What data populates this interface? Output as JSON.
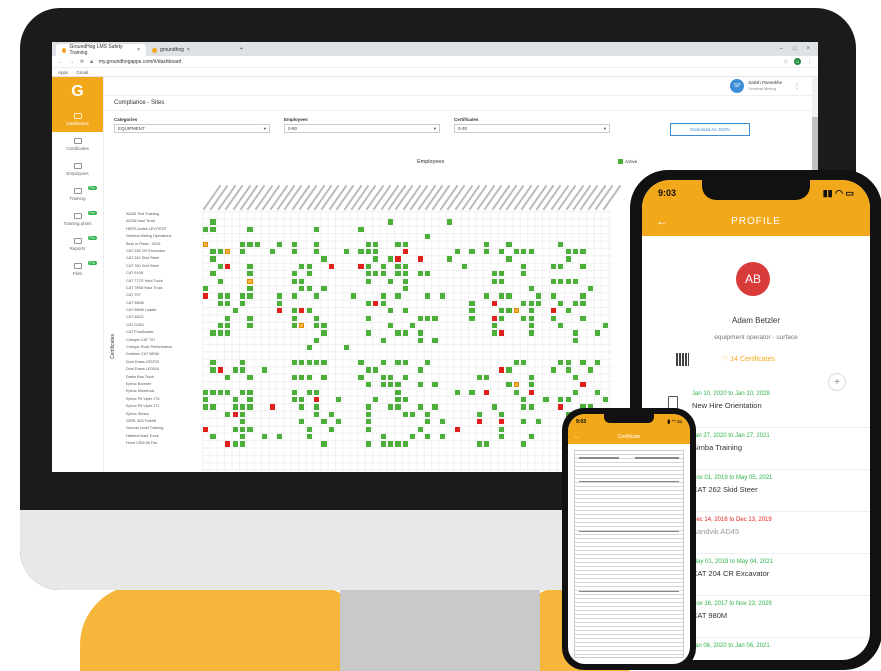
{
  "browser": {
    "tabs": [
      {
        "label": "GroundHog LMS Safety Training"
      },
      {
        "label": "groundhog"
      }
    ],
    "url": "my.groundhogapps.com/#/dashboard",
    "bookmarks": [
      "Apps",
      "Gmail"
    ],
    "account_initial": "G"
  },
  "app": {
    "logo": "G",
    "nav": [
      {
        "label": "Dashboard",
        "active": true
      },
      {
        "label": "Certificates"
      },
      {
        "label": "Employees"
      },
      {
        "label": "Training",
        "badge": "Pro"
      },
      {
        "label": "Training plans",
        "badge": "Pro"
      },
      {
        "label": "Reports",
        "badge": "Pro"
      },
      {
        "label": "Files",
        "badge": "Pro"
      }
    ],
    "user": {
      "initials": "SP",
      "name": "Satish Pansekhe",
      "subtitle": "Xcentral Mining"
    },
    "page_title": "Compliance - Sites",
    "filters": [
      {
        "label": "Categories",
        "value": "EQUIPMENT"
      },
      {
        "label": "Employees",
        "value": "0-50"
      },
      {
        "label": "Certificates",
        "value": "0-30"
      }
    ],
    "download_button": "Download As JSON",
    "matrix": {
      "employees_label": "Employees",
      "certificates_label": "Certificates",
      "legend_active": "Active",
      "rows": [
        "ADAS Test Training",
        "ADSA Haul Truck",
        "HERS Active LEVITEST",
        "General Mining Operations",
        "Bear in Place - 2019",
        "CAT 236 CR Excavator",
        "CAT 262 Skid Steer",
        "CAT 760 Grid Steer",
        "CAT 914B",
        "CAT 777G Haul Truck",
        "CAT 789D Haul Truck",
        "CAT 797",
        "CAT 980M",
        "CAT 980M Loader",
        "CAT AD22",
        "CAT D10U",
        "CAT Frontloader",
        "Chrispix CAT 797",
        "Chrispix Rock Performance",
        "Dobbies CAT 980M",
        "Doni Drass 22SF20",
        "Doni Drass LE0516",
        "Drake Bus Truck",
        "Epiroc Boomer",
        "Epiroc Minetruck",
        "Epiroc Pit Viper 275",
        "Epiroc Pit Viper 271",
        "Epiroc Simba",
        "GERL 303 Forklift",
        "Ground Level Training",
        "Hartmot Haul Truck",
        "Horst CEM 66 Fan"
      ]
    }
  },
  "profile_phone": {
    "time": "9:03",
    "header": "PROFILE",
    "back": "←",
    "avatar_initials": "AB",
    "name": "Adam Betzler",
    "role": "equipment operator - surface",
    "certificates_count": "14 Certificates",
    "plus": "+",
    "certificates": [
      {
        "dates": "Jan 10, 2020 to Jan 10, 2029",
        "name": "New Hire Orientation",
        "status": "valid"
      },
      {
        "dates": "Jan 27, 2020 to Jan 27, 2021",
        "name": "Simba Training",
        "status": "valid"
      },
      {
        "dates": "Nov 01, 2019 to May 05, 2021",
        "name": "CAT 262 Skid Steer",
        "status": "valid"
      },
      {
        "dates": "Dec 14, 2016 to Dec 13, 2019",
        "name": "Sandvik AD45",
        "status": "expired"
      },
      {
        "dates": "May 01, 2019 to May 04, 2021",
        "name": "CAT 204 CR Excavator",
        "status": "valid"
      },
      {
        "dates": "Nov 16, 2017 to Nov 23, 2029",
        "name": "CAT 980M",
        "status": "valid"
      },
      {
        "dates": "Jan 06, 2020 to Jan 06, 2021",
        "name": "",
        "status": "valid"
      }
    ]
  },
  "certificate_phone": {
    "time": "9:03",
    "header": "Certificate",
    "back": "←"
  },
  "colors": {
    "brand": "#f2a81b",
    "active": "#4caf3a",
    "expired": "#e0201d",
    "pending": "#f5b540"
  }
}
